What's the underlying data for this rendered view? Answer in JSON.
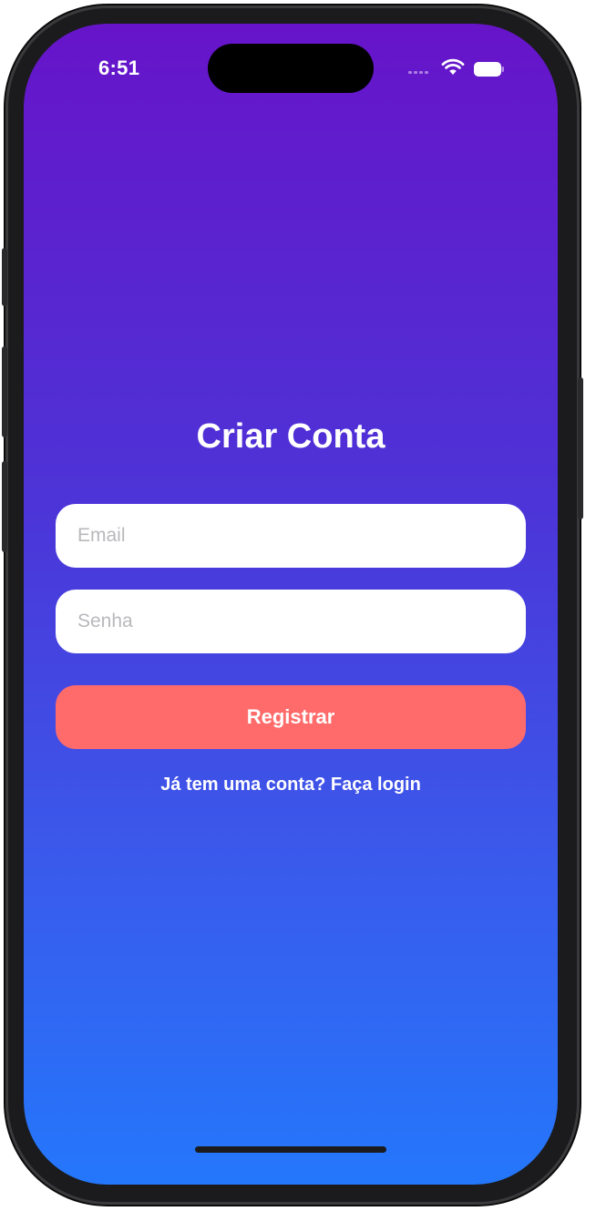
{
  "status_bar": {
    "time": "6:51",
    "icons": [
      "cellular-signal-icon",
      "wifi-icon",
      "battery-icon"
    ]
  },
  "screen": {
    "title": "Criar Conta",
    "email": {
      "placeholder": "Email",
      "value": ""
    },
    "password": {
      "placeholder": "Senha",
      "value": ""
    },
    "register_label": "Registrar",
    "login_link": "Já tem uma conta? Faça login"
  },
  "colors": {
    "gradient_top": "#6714c9",
    "gradient_bottom": "#2477fb",
    "button": "#ff6b6b",
    "input_bg": "#ffffff",
    "text": "#ffffff"
  }
}
